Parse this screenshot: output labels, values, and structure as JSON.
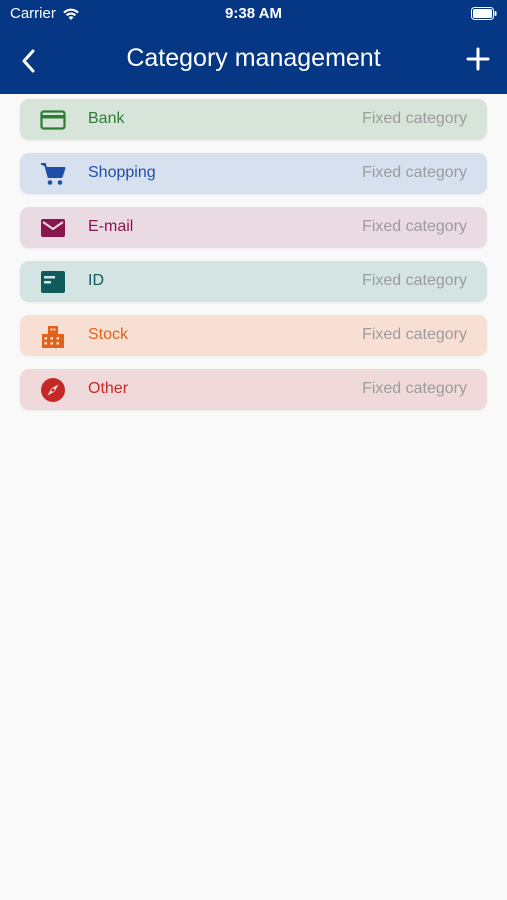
{
  "status_bar": {
    "carrier": "Carrier",
    "time": "9:38 AM"
  },
  "nav": {
    "title": "Category management"
  },
  "colors": {
    "header_bg": "#053785",
    "bank": {
      "bg": "#d6e4d9",
      "fg": "#2e7d32"
    },
    "shopping": {
      "bg": "#d6e0ee",
      "fg": "#1e4fa8"
    },
    "email": {
      "bg": "#eadae2",
      "fg": "#8a1650"
    },
    "id": {
      "bg": "#d3e4e3",
      "fg": "#0f5b5b"
    },
    "stock": {
      "bg": "#f8dfd4",
      "fg": "#e2621b"
    },
    "other": {
      "bg": "#f0d9da",
      "fg": "#c62828"
    }
  },
  "categories": [
    {
      "label": "Bank",
      "tag": "Fixed category",
      "icon": "credit-card-icon"
    },
    {
      "label": "Shopping",
      "tag": "Fixed category",
      "icon": "shopping-cart-icon"
    },
    {
      "label": "E-mail",
      "tag": "Fixed category",
      "icon": "mail-icon"
    },
    {
      "label": "ID",
      "tag": "Fixed category",
      "icon": "id-card-icon"
    },
    {
      "label": "Stock",
      "tag": "Fixed category",
      "icon": "building-icon"
    },
    {
      "label": "Other",
      "tag": "Fixed category",
      "icon": "compass-icon"
    }
  ]
}
